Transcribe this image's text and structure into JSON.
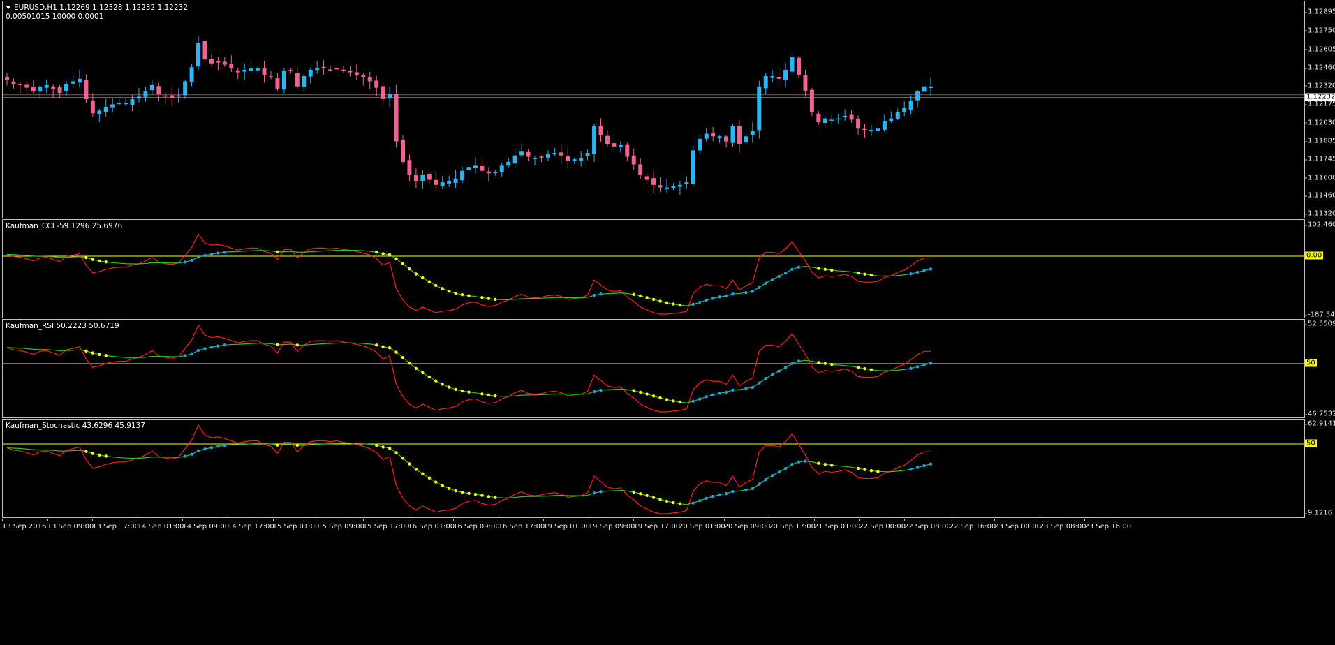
{
  "main": {
    "symbol_line": "EURUSD,H1  1.12269 1.12328 1.12232 1.12232",
    "info_line": "0.00501015 10000 0.0001",
    "price_ticks": [
      "1.12895",
      "1.12750",
      "1.12605",
      "1.12460",
      "1.12320",
      "1.12175",
      "1.12030",
      "1.11885",
      "1.11745",
      "1.11600",
      "1.11460",
      "1.11320"
    ],
    "current_price": "1.12232",
    "colors": {
      "bull": "#29b6f6",
      "bear": "#f06292",
      "hline": "#c62828",
      "bid": "#ffffff"
    }
  },
  "indicators": [
    {
      "title": "Kaufman_CCI -59.1296 25.6976",
      "top_tick": "102.4605",
      "level_label": "0.00",
      "bottom_tick": "-187.5471"
    },
    {
      "title": "Kaufman_RSI 50.2223 50.6719",
      "top_tick": "52.5509",
      "level_label": "50",
      "bottom_tick": "46.7532"
    },
    {
      "title": "Kaufman_Stochastic 43.6296 45.9137",
      "top_tick": "62.9141",
      "level_label": "50",
      "bottom_tick": "9.1216"
    }
  ],
  "time_labels": [
    "13 Sep 2016",
    "13 Sep 09:00",
    "13 Sep 17:00",
    "14 Sep 01:00",
    "14 Sep 09:00",
    "14 Sep 17:00",
    "15 Sep 01:00",
    "15 Sep 09:00",
    "15 Sep 17:00",
    "16 Sep 01:00",
    "16 Sep 09:00",
    "16 Sep 17:00",
    "19 Sep 01:00",
    "19 Sep 09:00",
    "19 Sep 17:00",
    "20 Sep 01:00",
    "20 Sep 09:00",
    "20 Sep 17:00",
    "21 Sep 01:00",
    "22 Sep 00:00",
    "22 Sep 08:00",
    "22 Sep 16:00",
    "23 Sep 00:00",
    "23 Sep 08:00",
    "23 Sep 16:00"
  ],
  "chart_data": {
    "type": "candlestick",
    "ylim": [
      1.1132,
      1.1293
    ],
    "close_trace": [
      1.1237,
      1.1234,
      1.1233,
      1.1231,
      1.1228,
      1.1232,
      1.1233,
      1.123,
      1.1227,
      1.1234,
      1.1236,
      1.1238,
      1.1222,
      1.1211,
      1.1213,
      1.1216,
      1.1218,
      1.1219,
      1.1219,
      1.1222,
      1.1224,
      1.1228,
      1.1233,
      1.1226,
      1.1224,
      1.1223,
      1.1225,
      1.1236,
      1.1247,
      1.1266,
      1.1253,
      1.125,
      1.1251,
      1.1249,
      1.1246,
      1.1243,
      1.1245,
      1.1246,
      1.1246,
      1.1241,
      1.1239,
      1.123,
      1.1244,
      1.1244,
      1.1232,
      1.124,
      1.1245,
      1.1246,
      1.1246,
      1.1245,
      1.1246,
      1.1244,
      1.1243,
      1.1241,
      1.1239,
      1.1236,
      1.1231,
      1.1222,
      1.1226,
      1.1189,
      1.1173,
      1.1163,
      1.1158,
      1.1163,
      1.1159,
      1.1155,
      1.1157,
      1.1158,
      1.116,
      1.1166,
      1.1169,
      1.117,
      1.1166,
      1.1164,
      1.1165,
      1.117,
      1.1173,
      1.1178,
      1.1181,
      1.1177,
      1.1176,
      1.1177,
      1.1179,
      1.118,
      1.1178,
      1.1174,
      1.1175,
      1.1176,
      1.118,
      1.1201,
      1.1194,
      1.1187,
      1.1185,
      1.1186,
      1.1177,
      1.1171,
      1.1163,
      1.1159,
      1.1155,
      1.1153,
      1.1153,
      1.1154,
      1.1155,
      1.1157,
      1.1182,
      1.1191,
      1.1195,
      1.1193,
      1.1193,
      1.1189,
      1.1201,
      1.1187,
      1.1193,
      1.1197,
      1.1232,
      1.124,
      1.124,
      1.1238,
      1.1245,
      1.1255,
      1.1241,
      1.1228,
      1.1212,
      1.1204,
      1.1207,
      1.1206,
      1.1207,
      1.1209,
      1.1206,
      1.1199,
      1.1198,
      1.1198,
      1.1199,
      1.1205,
      1.1207,
      1.1212,
      1.1215,
      1.1221,
      1.1228,
      1.1232,
      1.1232
    ],
    "cci": {
      "ylim": [
        -187.5471,
        102.4605
      ],
      "level": 0
    },
    "rsi": {
      "ylim": [
        46.7532,
        52.5509
      ],
      "level": 50
    },
    "stochastic": {
      "ylim": [
        9.1216,
        62.9141
      ],
      "level": 50
    }
  }
}
